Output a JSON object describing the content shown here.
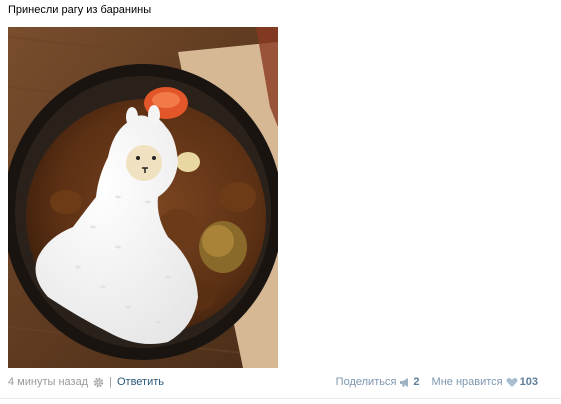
{
  "post": {
    "text": "Принесли рагу из баранины",
    "photo_alt": "",
    "footer": {
      "timestamp": "4 минуты назад",
      "separator": "|",
      "reply_label": "Ответить",
      "share_label": "Поделиться",
      "share_count": "2",
      "like_label": "Мне нравится",
      "like_count": "103"
    }
  },
  "colors": {
    "link": "#2b587a",
    "muted": "#999999",
    "action": "#7d97af",
    "count": "#5e7e9a"
  },
  "icons": {
    "settings": "gear-icon",
    "share": "megaphone-icon",
    "like": "heart-icon"
  }
}
